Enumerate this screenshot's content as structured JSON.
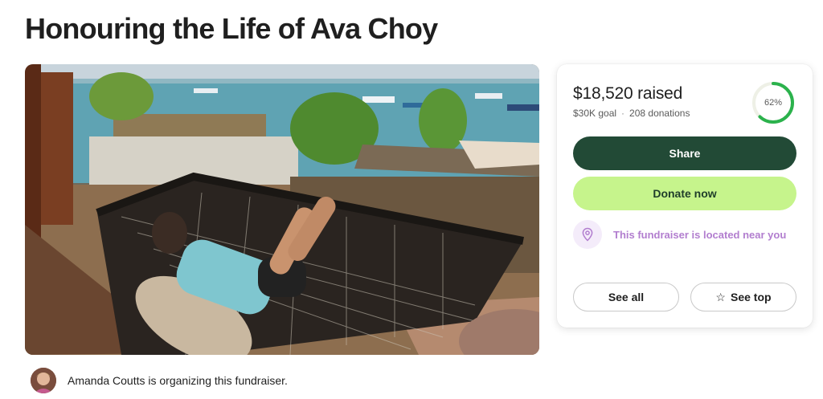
{
  "page": {
    "title": "Honouring the Life of Ava Choy"
  },
  "organizer": {
    "text": "Amanda Coutts is organizing this fundraiser."
  },
  "donation": {
    "raised": "$18,520 raised",
    "goal": "$30K goal",
    "separator": "·",
    "donations": "208 donations",
    "progress_label": "62%",
    "progress_fraction": 0.62,
    "ring_color": "#2bb24c",
    "ring_track_color": "#eef0e6"
  },
  "actions": {
    "share_label": "Share",
    "donate_label": "Donate now",
    "near_label": "This fundraiser is located near you",
    "see_all_label": "See all",
    "see_top_label": "See top",
    "star_icon": "☆"
  },
  "colors": {
    "share_bg": "#224a36",
    "donate_bg": "#c6f48c",
    "near_text": "#b27ecf"
  }
}
